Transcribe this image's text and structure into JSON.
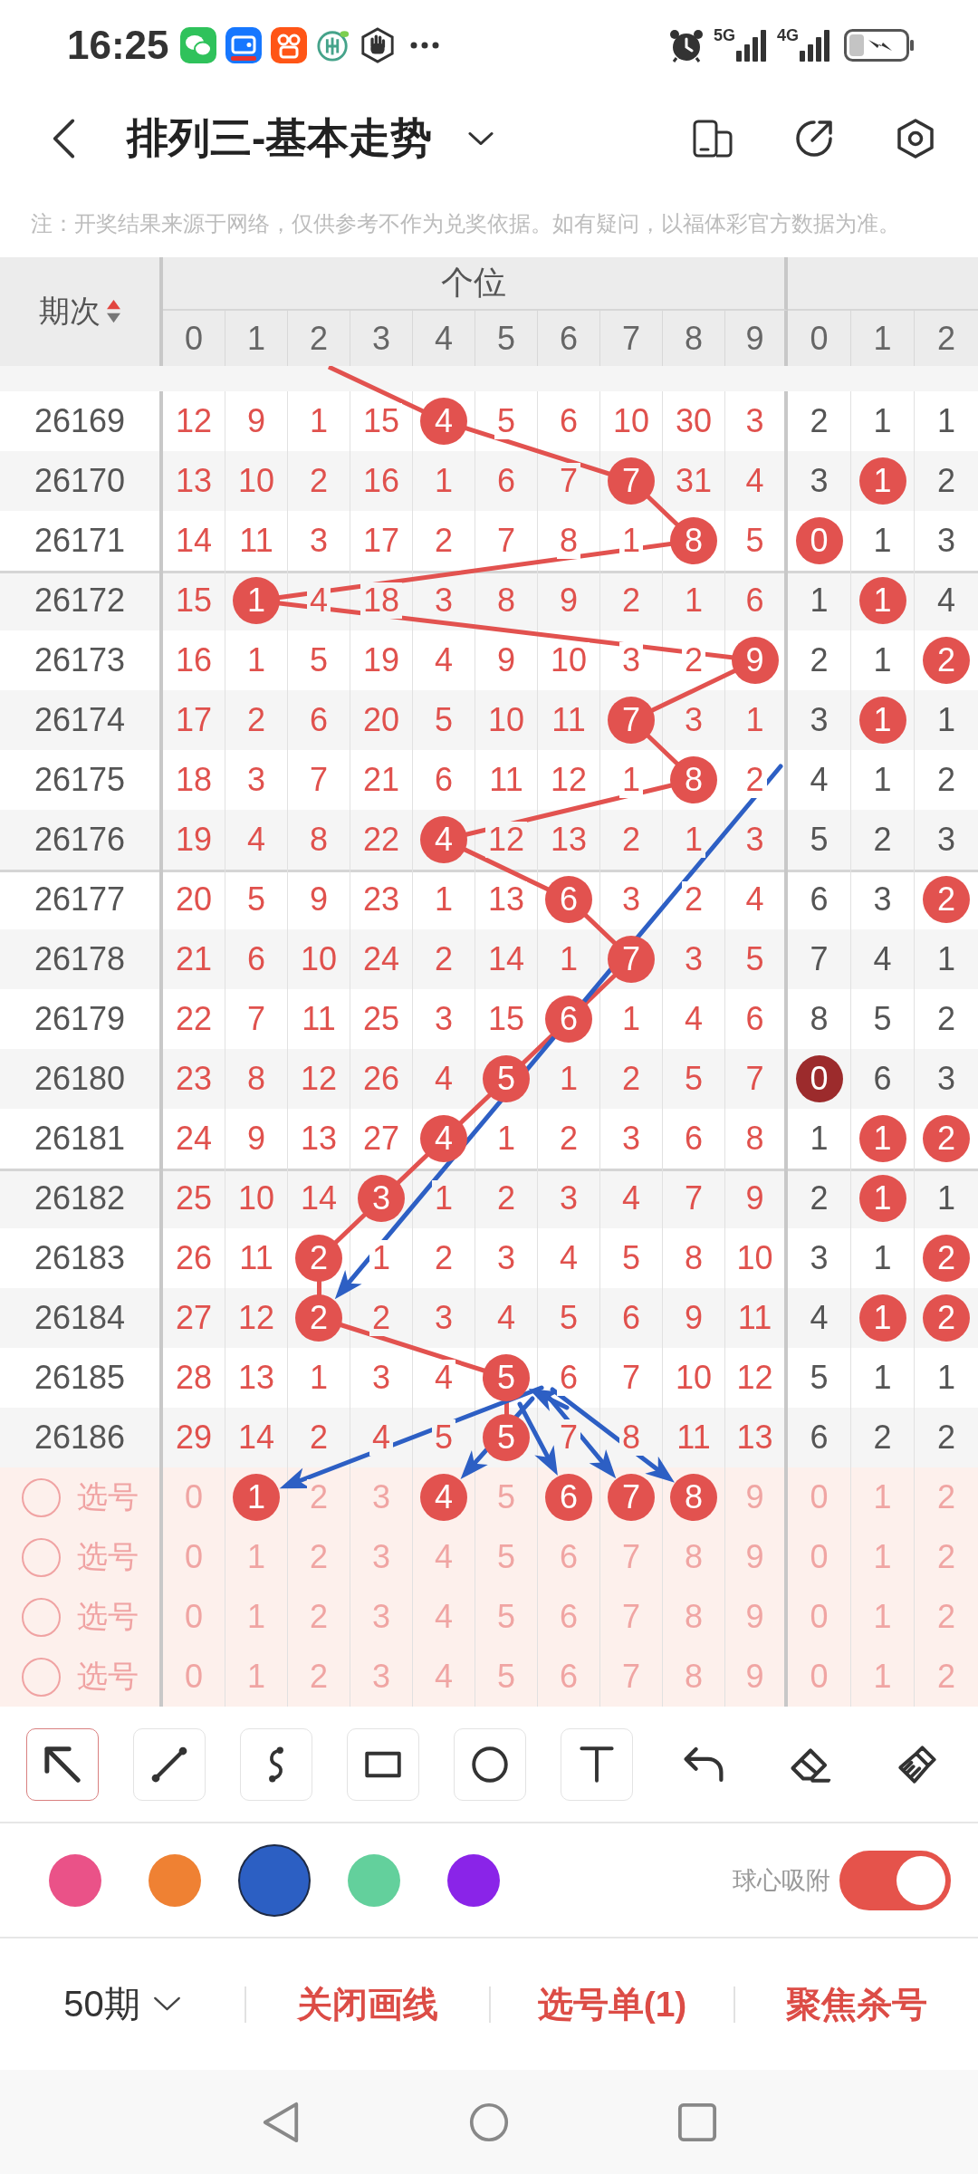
{
  "status_bar": {
    "time": "16:25",
    "networks": [
      "5G",
      "4G"
    ]
  },
  "header": {
    "title": "排列三-基本走势"
  },
  "notice": "注：开奖结果来源于网络，仅供参考不作为兑奖依据。如有疑问，以福体彩官方数据为准。",
  "table": {
    "period_header": "期次",
    "group_header": "个位",
    "unit_digits": [
      "0",
      "1",
      "2",
      "3",
      "4",
      "5",
      "6",
      "7",
      "8",
      "9"
    ],
    "extra_digits": [
      "0",
      "1",
      "2"
    ],
    "rows": [
      {
        "period": "26169",
        "units": [
          {
            "text": "12",
            "hit": false
          },
          {
            "text": "9",
            "hit": false
          },
          {
            "text": "1",
            "hit": false
          },
          {
            "text": "15",
            "hit": false
          },
          {
            "text": "4",
            "hit": true,
            "color": "#e2524f"
          },
          {
            "text": "5",
            "hit": false
          },
          {
            "text": "6",
            "hit": false
          },
          {
            "text": "10",
            "hit": false
          },
          {
            "text": "30",
            "hit": false
          },
          {
            "text": "3",
            "hit": false
          }
        ],
        "extra": [
          {
            "text": "2",
            "hit": false
          },
          {
            "text": "1",
            "hit": false
          },
          {
            "text": "1",
            "hit": false
          }
        ]
      },
      {
        "period": "26170",
        "units": [
          {
            "text": "13",
            "hit": false
          },
          {
            "text": "10",
            "hit": false
          },
          {
            "text": "2",
            "hit": false
          },
          {
            "text": "16",
            "hit": false
          },
          {
            "text": "1",
            "hit": false
          },
          {
            "text": "6",
            "hit": false
          },
          {
            "text": "7",
            "hit": false
          },
          {
            "text": "7",
            "hit": true,
            "color": "#e2524f"
          },
          {
            "text": "31",
            "hit": false
          },
          {
            "text": "4",
            "hit": false
          }
        ],
        "extra": [
          {
            "text": "3",
            "hit": false
          },
          {
            "text": "1",
            "hit": true,
            "color": "#e2524f"
          },
          {
            "text": "2",
            "hit": false
          }
        ]
      },
      {
        "period": "26171",
        "units": [
          {
            "text": "14",
            "hit": false
          },
          {
            "text": "11",
            "hit": false
          },
          {
            "text": "3",
            "hit": false
          },
          {
            "text": "17",
            "hit": false
          },
          {
            "text": "2",
            "hit": false
          },
          {
            "text": "7",
            "hit": false
          },
          {
            "text": "8",
            "hit": false
          },
          {
            "text": "1",
            "hit": false
          },
          {
            "text": "8",
            "hit": true,
            "color": "#e2524f"
          },
          {
            "text": "5",
            "hit": false
          }
        ],
        "extra": [
          {
            "text": "0",
            "hit": true,
            "color": "#e2524f"
          },
          {
            "text": "1",
            "hit": false
          },
          {
            "text": "3",
            "hit": false
          }
        ]
      },
      {
        "period": "26172",
        "units": [
          {
            "text": "15",
            "hit": false
          },
          {
            "text": "1",
            "hit": true,
            "color": "#e2524f"
          },
          {
            "text": "4",
            "hit": false
          },
          {
            "text": "18",
            "hit": false
          },
          {
            "text": "3",
            "hit": false
          },
          {
            "text": "8",
            "hit": false
          },
          {
            "text": "9",
            "hit": false
          },
          {
            "text": "2",
            "hit": false
          },
          {
            "text": "1",
            "hit": false
          },
          {
            "text": "6",
            "hit": false
          }
        ],
        "extra": [
          {
            "text": "1",
            "hit": false
          },
          {
            "text": "1",
            "hit": true,
            "color": "#e2524f"
          },
          {
            "text": "4",
            "hit": false
          }
        ]
      },
      {
        "period": "26173",
        "units": [
          {
            "text": "16",
            "hit": false
          },
          {
            "text": "1",
            "hit": false
          },
          {
            "text": "5",
            "hit": false
          },
          {
            "text": "19",
            "hit": false
          },
          {
            "text": "4",
            "hit": false
          },
          {
            "text": "9",
            "hit": false
          },
          {
            "text": "10",
            "hit": false
          },
          {
            "text": "3",
            "hit": false
          },
          {
            "text": "2",
            "hit": false
          },
          {
            "text": "9",
            "hit": true,
            "color": "#e2524f"
          }
        ],
        "extra": [
          {
            "text": "2",
            "hit": false
          },
          {
            "text": "1",
            "hit": false
          },
          {
            "text": "2",
            "hit": true,
            "color": "#e2524f"
          }
        ]
      },
      {
        "period": "26174",
        "units": [
          {
            "text": "17",
            "hit": false
          },
          {
            "text": "2",
            "hit": false
          },
          {
            "text": "6",
            "hit": false
          },
          {
            "text": "20",
            "hit": false
          },
          {
            "text": "5",
            "hit": false
          },
          {
            "text": "10",
            "hit": false
          },
          {
            "text": "11",
            "hit": false
          },
          {
            "text": "7",
            "hit": true,
            "color": "#e2524f"
          },
          {
            "text": "3",
            "hit": false
          },
          {
            "text": "1",
            "hit": false
          }
        ],
        "extra": [
          {
            "text": "3",
            "hit": false
          },
          {
            "text": "1",
            "hit": true,
            "color": "#e2524f"
          },
          {
            "text": "1",
            "hit": false
          }
        ]
      },
      {
        "period": "26175",
        "units": [
          {
            "text": "18",
            "hit": false
          },
          {
            "text": "3",
            "hit": false
          },
          {
            "text": "7",
            "hit": false
          },
          {
            "text": "21",
            "hit": false
          },
          {
            "text": "6",
            "hit": false
          },
          {
            "text": "11",
            "hit": false
          },
          {
            "text": "12",
            "hit": false
          },
          {
            "text": "1",
            "hit": false
          },
          {
            "text": "8",
            "hit": true,
            "color": "#e2524f"
          },
          {
            "text": "2",
            "hit": false
          }
        ],
        "extra": [
          {
            "text": "4",
            "hit": false
          },
          {
            "text": "1",
            "hit": false
          },
          {
            "text": "2",
            "hit": false
          }
        ]
      },
      {
        "period": "26176",
        "units": [
          {
            "text": "19",
            "hit": false
          },
          {
            "text": "4",
            "hit": false
          },
          {
            "text": "8",
            "hit": false
          },
          {
            "text": "22",
            "hit": false
          },
          {
            "text": "4",
            "hit": true,
            "color": "#e2524f"
          },
          {
            "text": "12",
            "hit": false
          },
          {
            "text": "13",
            "hit": false
          },
          {
            "text": "2",
            "hit": false
          },
          {
            "text": "1",
            "hit": false
          },
          {
            "text": "3",
            "hit": false
          }
        ],
        "extra": [
          {
            "text": "5",
            "hit": false
          },
          {
            "text": "2",
            "hit": false
          },
          {
            "text": "3",
            "hit": false
          }
        ]
      },
      {
        "period": "26177",
        "units": [
          {
            "text": "20",
            "hit": false
          },
          {
            "text": "5",
            "hit": false
          },
          {
            "text": "9",
            "hit": false
          },
          {
            "text": "23",
            "hit": false
          },
          {
            "text": "1",
            "hit": false
          },
          {
            "text": "13",
            "hit": false
          },
          {
            "text": "6",
            "hit": true,
            "color": "#e2524f"
          },
          {
            "text": "3",
            "hit": false
          },
          {
            "text": "2",
            "hit": false
          },
          {
            "text": "4",
            "hit": false
          }
        ],
        "extra": [
          {
            "text": "6",
            "hit": false
          },
          {
            "text": "3",
            "hit": false
          },
          {
            "text": "2",
            "hit": true,
            "color": "#e2524f"
          }
        ]
      },
      {
        "period": "26178",
        "units": [
          {
            "text": "21",
            "hit": false
          },
          {
            "text": "6",
            "hit": false
          },
          {
            "text": "10",
            "hit": false
          },
          {
            "text": "24",
            "hit": false
          },
          {
            "text": "2",
            "hit": false
          },
          {
            "text": "14",
            "hit": false
          },
          {
            "text": "1",
            "hit": false
          },
          {
            "text": "7",
            "hit": true,
            "color": "#e2524f"
          },
          {
            "text": "3",
            "hit": false
          },
          {
            "text": "5",
            "hit": false
          }
        ],
        "extra": [
          {
            "text": "7",
            "hit": false
          },
          {
            "text": "4",
            "hit": false
          },
          {
            "text": "1",
            "hit": false
          }
        ]
      },
      {
        "period": "26179",
        "units": [
          {
            "text": "22",
            "hit": false
          },
          {
            "text": "7",
            "hit": false
          },
          {
            "text": "11",
            "hit": false
          },
          {
            "text": "25",
            "hit": false
          },
          {
            "text": "3",
            "hit": false
          },
          {
            "text": "15",
            "hit": false
          },
          {
            "text": "6",
            "hit": true,
            "color": "#e2524f"
          },
          {
            "text": "1",
            "hit": false
          },
          {
            "text": "4",
            "hit": false
          },
          {
            "text": "6",
            "hit": false
          }
        ],
        "extra": [
          {
            "text": "8",
            "hit": false
          },
          {
            "text": "5",
            "hit": false
          },
          {
            "text": "2",
            "hit": false
          }
        ]
      },
      {
        "period": "26180",
        "units": [
          {
            "text": "23",
            "hit": false
          },
          {
            "text": "8",
            "hit": false
          },
          {
            "text": "12",
            "hit": false
          },
          {
            "text": "26",
            "hit": false
          },
          {
            "text": "4",
            "hit": false
          },
          {
            "text": "5",
            "hit": true,
            "color": "#e2524f"
          },
          {
            "text": "1",
            "hit": false
          },
          {
            "text": "2",
            "hit": false
          },
          {
            "text": "5",
            "hit": false
          },
          {
            "text": "7",
            "hit": false
          }
        ],
        "extra": [
          {
            "text": "0",
            "hit": true,
            "color": "#9c2b2c"
          },
          {
            "text": "6",
            "hit": false
          },
          {
            "text": "3",
            "hit": false
          }
        ]
      },
      {
        "period": "26181",
        "units": [
          {
            "text": "24",
            "hit": false
          },
          {
            "text": "9",
            "hit": false
          },
          {
            "text": "13",
            "hit": false
          },
          {
            "text": "27",
            "hit": false
          },
          {
            "text": "4",
            "hit": true,
            "color": "#e2524f"
          },
          {
            "text": "1",
            "hit": false
          },
          {
            "text": "2",
            "hit": false
          },
          {
            "text": "3",
            "hit": false
          },
          {
            "text": "6",
            "hit": false
          },
          {
            "text": "8",
            "hit": false
          }
        ],
        "extra": [
          {
            "text": "1",
            "hit": false
          },
          {
            "text": "1",
            "hit": true,
            "color": "#e2524f"
          },
          {
            "text": "2",
            "hit": true,
            "color": "#e2524f"
          }
        ]
      },
      {
        "period": "26182",
        "units": [
          {
            "text": "25",
            "hit": false
          },
          {
            "text": "10",
            "hit": false
          },
          {
            "text": "14",
            "hit": false
          },
          {
            "text": "3",
            "hit": true,
            "color": "#e2524f"
          },
          {
            "text": "1",
            "hit": false
          },
          {
            "text": "2",
            "hit": false
          },
          {
            "text": "3",
            "hit": false
          },
          {
            "text": "4",
            "hit": false
          },
          {
            "text": "7",
            "hit": false
          },
          {
            "text": "9",
            "hit": false
          }
        ],
        "extra": [
          {
            "text": "2",
            "hit": false
          },
          {
            "text": "1",
            "hit": true,
            "color": "#e2524f"
          },
          {
            "text": "1",
            "hit": false
          }
        ]
      },
      {
        "period": "26183",
        "units": [
          {
            "text": "26",
            "hit": false
          },
          {
            "text": "11",
            "hit": false
          },
          {
            "text": "2",
            "hit": true,
            "color": "#e2524f"
          },
          {
            "text": "1",
            "hit": false
          },
          {
            "text": "2",
            "hit": false
          },
          {
            "text": "3",
            "hit": false
          },
          {
            "text": "4",
            "hit": false
          },
          {
            "text": "5",
            "hit": false
          },
          {
            "text": "8",
            "hit": false
          },
          {
            "text": "10",
            "hit": false
          }
        ],
        "extra": [
          {
            "text": "3",
            "hit": false
          },
          {
            "text": "1",
            "hit": false
          },
          {
            "text": "2",
            "hit": true,
            "color": "#e2524f"
          }
        ]
      },
      {
        "period": "26184",
        "units": [
          {
            "text": "27",
            "hit": false
          },
          {
            "text": "12",
            "hit": false
          },
          {
            "text": "2",
            "hit": true,
            "color": "#e2524f"
          },
          {
            "text": "2",
            "hit": false
          },
          {
            "text": "3",
            "hit": false
          },
          {
            "text": "4",
            "hit": false
          },
          {
            "text": "5",
            "hit": false
          },
          {
            "text": "6",
            "hit": false
          },
          {
            "text": "9",
            "hit": false
          },
          {
            "text": "11",
            "hit": false
          }
        ],
        "extra": [
          {
            "text": "4",
            "hit": false
          },
          {
            "text": "1",
            "hit": true,
            "color": "#e2524f"
          },
          {
            "text": "2",
            "hit": true,
            "color": "#e2524f"
          }
        ]
      },
      {
        "period": "26185",
        "units": [
          {
            "text": "28",
            "hit": false
          },
          {
            "text": "13",
            "hit": false
          },
          {
            "text": "1",
            "hit": false
          },
          {
            "text": "3",
            "hit": false
          },
          {
            "text": "4",
            "hit": false
          },
          {
            "text": "5",
            "hit": true,
            "color": "#e2524f"
          },
          {
            "text": "6",
            "hit": false
          },
          {
            "text": "7",
            "hit": false
          },
          {
            "text": "10",
            "hit": false
          },
          {
            "text": "12",
            "hit": false
          }
        ],
        "extra": [
          {
            "text": "5",
            "hit": false
          },
          {
            "text": "1",
            "hit": false
          },
          {
            "text": "1",
            "hit": false
          }
        ]
      },
      {
        "period": "26186",
        "units": [
          {
            "text": "29",
            "hit": false
          },
          {
            "text": "14",
            "hit": false
          },
          {
            "text": "2",
            "hit": false
          },
          {
            "text": "4",
            "hit": false
          },
          {
            "text": "5",
            "hit": false
          },
          {
            "text": "5",
            "hit": true,
            "color": "#e2524f"
          },
          {
            "text": "7",
            "hit": false
          },
          {
            "text": "8",
            "hit": false
          },
          {
            "text": "11",
            "hit": false
          },
          {
            "text": "13",
            "hit": false
          }
        ],
        "extra": [
          {
            "text": "6",
            "hit": false
          },
          {
            "text": "2",
            "hit": false
          },
          {
            "text": "2",
            "hit": false
          }
        ]
      }
    ],
    "picker_rows": [
      {
        "checked": false,
        "label": "选号",
        "units": [
          {
            "text": "0",
            "selected": false
          },
          {
            "text": "1",
            "selected": true
          },
          {
            "text": "2",
            "selected": false
          },
          {
            "text": "3",
            "selected": false
          },
          {
            "text": "4",
            "selected": true
          },
          {
            "text": "5",
            "selected": false
          },
          {
            "text": "6",
            "selected": true
          },
          {
            "text": "7",
            "selected": true
          },
          {
            "text": "8",
            "selected": true
          },
          {
            "text": "9",
            "selected": false
          }
        ],
        "extra": [
          {
            "text": "0",
            "selected": false
          },
          {
            "text": "1",
            "selected": false
          },
          {
            "text": "2",
            "selected": false
          }
        ]
      },
      {
        "checked": false,
        "label": "选号",
        "units": [
          {
            "text": "0",
            "selected": false
          },
          {
            "text": "1",
            "selected": false
          },
          {
            "text": "2",
            "selected": false
          },
          {
            "text": "3",
            "selected": false
          },
          {
            "text": "4",
            "selected": false
          },
          {
            "text": "5",
            "selected": false
          },
          {
            "text": "6",
            "selected": false
          },
          {
            "text": "7",
            "selected": false
          },
          {
            "text": "8",
            "selected": false
          },
          {
            "text": "9",
            "selected": false
          }
        ],
        "extra": [
          {
            "text": "0",
            "selected": false
          },
          {
            "text": "1",
            "selected": false
          },
          {
            "text": "2",
            "selected": false
          }
        ]
      },
      {
        "checked": false,
        "label": "选号",
        "units": [
          {
            "text": "0",
            "selected": false
          },
          {
            "text": "1",
            "selected": false
          },
          {
            "text": "2",
            "selected": false
          },
          {
            "text": "3",
            "selected": false
          },
          {
            "text": "4",
            "selected": false
          },
          {
            "text": "5",
            "selected": false
          },
          {
            "text": "6",
            "selected": false
          },
          {
            "text": "7",
            "selected": false
          },
          {
            "text": "8",
            "selected": false
          },
          {
            "text": "9",
            "selected": false
          }
        ],
        "extra": [
          {
            "text": "0",
            "selected": false
          },
          {
            "text": "1",
            "selected": false
          },
          {
            "text": "2",
            "selected": false
          }
        ]
      },
      {
        "checked": false,
        "label": "选号",
        "units": [
          {
            "text": "0",
            "selected": false
          },
          {
            "text": "1",
            "selected": false
          },
          {
            "text": "2",
            "selected": false
          },
          {
            "text": "3",
            "selected": false
          },
          {
            "text": "4",
            "selected": false
          },
          {
            "text": "5",
            "selected": false
          },
          {
            "text": "6",
            "selected": false
          },
          {
            "text": "7",
            "selected": false
          },
          {
            "text": "8",
            "selected": false
          },
          {
            "text": "9",
            "selected": false
          }
        ],
        "extra": [
          {
            "text": "0",
            "selected": false
          },
          {
            "text": "1",
            "selected": false
          },
          {
            "text": "2",
            "selected": false
          }
        ]
      }
    ]
  },
  "tools": [
    {
      "kind": "shape",
      "selected": true
    },
    {
      "kind": "shape",
      "selected": false
    },
    {
      "kind": "shape",
      "selected": false
    },
    {
      "kind": "shape",
      "selected": false
    },
    {
      "kind": "shape",
      "selected": false
    },
    {
      "kind": "shape",
      "selected": false
    },
    {
      "kind": "action",
      "selected": false
    },
    {
      "kind": "action",
      "selected": false
    },
    {
      "kind": "action",
      "selected": false
    }
  ],
  "colors": [
    {
      "color": "#ea5288",
      "selected": false
    },
    {
      "color": "#ef8133",
      "selected": false
    },
    {
      "color": "#2c5fc3",
      "selected": true
    },
    {
      "color": "#63d09c",
      "selected": false
    },
    {
      "color": "#8a24e8",
      "selected": false
    }
  ],
  "snap": {
    "label": "球心吸附",
    "on": true
  },
  "bottom_bar": {
    "period_select": "50期",
    "actions": [
      "关闭画线",
      "选号单(1)",
      "聚焦杀号"
    ]
  }
}
